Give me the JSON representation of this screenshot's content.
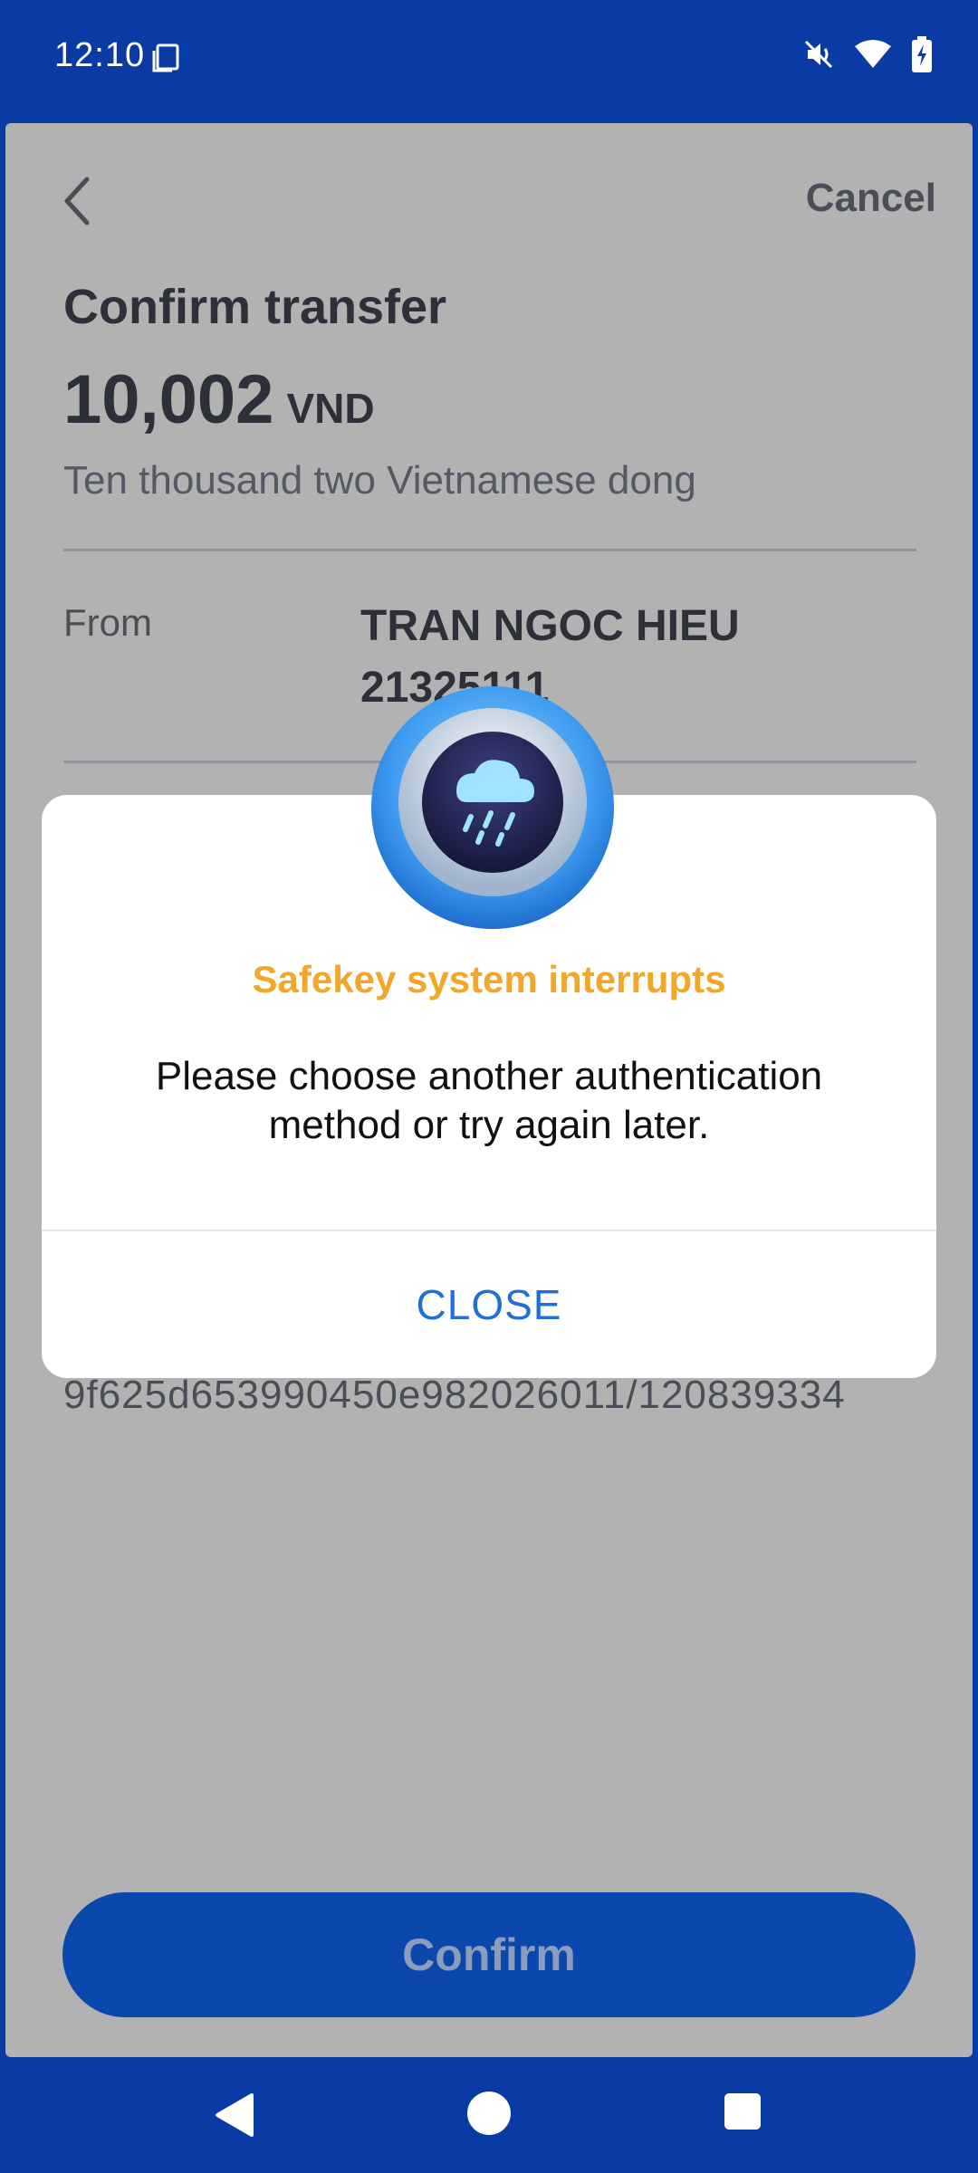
{
  "status_bar": {
    "time": "12:10",
    "icons": [
      "screen-icon",
      "mute-vibrate-icon",
      "wifi-icon",
      "battery-charging-icon"
    ]
  },
  "header": {
    "back_icon": "chevron-left-icon",
    "cancel_label": "Cancel"
  },
  "transfer": {
    "title": "Confirm transfer",
    "amount": "10,002",
    "currency": "VND",
    "amount_words": "Ten thousand two Vietnamese dong",
    "from_label": "From",
    "from_name": "TRAN NGOC HIEU",
    "from_account": "21325111",
    "reference": "9f625d653990450e982026011/120839334"
  },
  "confirm_button": {
    "label": "Confirm"
  },
  "modal": {
    "icon": "rain-cloud-icon",
    "title": "Safekey system interrupts",
    "message": "Please choose another authentication method or try again later.",
    "close_label": "CLOSE"
  },
  "nav_bar": {
    "icons": [
      "back-triangle-icon",
      "home-circle-icon",
      "recents-square-icon"
    ]
  },
  "colors": {
    "brand_blue": "#0a3aa3",
    "warning_orange": "#f2a72a",
    "link_blue": "#1f6fd6",
    "overlay_gray": "#b2b2b2"
  }
}
